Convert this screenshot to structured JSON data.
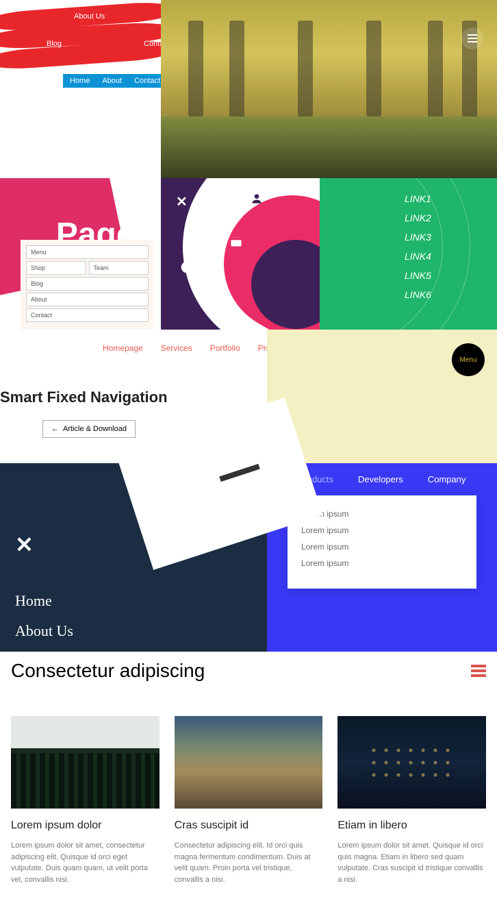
{
  "ribbon": {
    "aboutus": "About Us",
    "blog": "Blog",
    "contact": "Contact",
    "topnav": [
      "Home",
      "About",
      "Contact"
    ]
  },
  "page": {
    "ageText": "Page",
    "form": {
      "menu": "Menu",
      "shop": "Shop",
      "team": "Team",
      "blog": "Blog",
      "about": "About",
      "contact": "Contact"
    }
  },
  "radialLinks": [
    "LINK1",
    "LINK2",
    "LINK3",
    "LINK4",
    "LINK5",
    "LINK6"
  ],
  "nav": {
    "items": [
      "Homepage",
      "Services",
      "Portfolio",
      "Pricing"
    ],
    "title": "Smart Fixed Navigation",
    "button": "Article & Download"
  },
  "menuCircle": "Menu",
  "chalk": {
    "home": "Home",
    "about": "About Us"
  },
  "dropdown": {
    "tabs": [
      "Products",
      "Developers",
      "Company"
    ],
    "items": [
      "Lorem ipsum",
      "Lorem ipsum",
      "Lorem ipsum",
      "Lorem ipsum"
    ]
  },
  "article": {
    "title": "Consectetur adipiscing",
    "cards": [
      {
        "title": "Lorem ipsum dolor",
        "body": "Lorem ipsum dolor sit amet, consectetur adipiscing elit. Quisque id orci eget vulputate. Duis quam quam, ut velit porta vel, convallis nisi."
      },
      {
        "title": "Cras suscipit id",
        "body": "Consectetur adipiscing elit. Id orci quis magna fermentum condimentum. Duis at velit quam. Proin porta vel tristique, convallis a nisi."
      },
      {
        "title": "Etiam in libero",
        "body": "Lorem ipsum dolor sit amet. Quisque id orci quis magna. Etiam in libero sed quam vulputate. Cras suscipit id tristique convallis a nisi."
      }
    ]
  }
}
